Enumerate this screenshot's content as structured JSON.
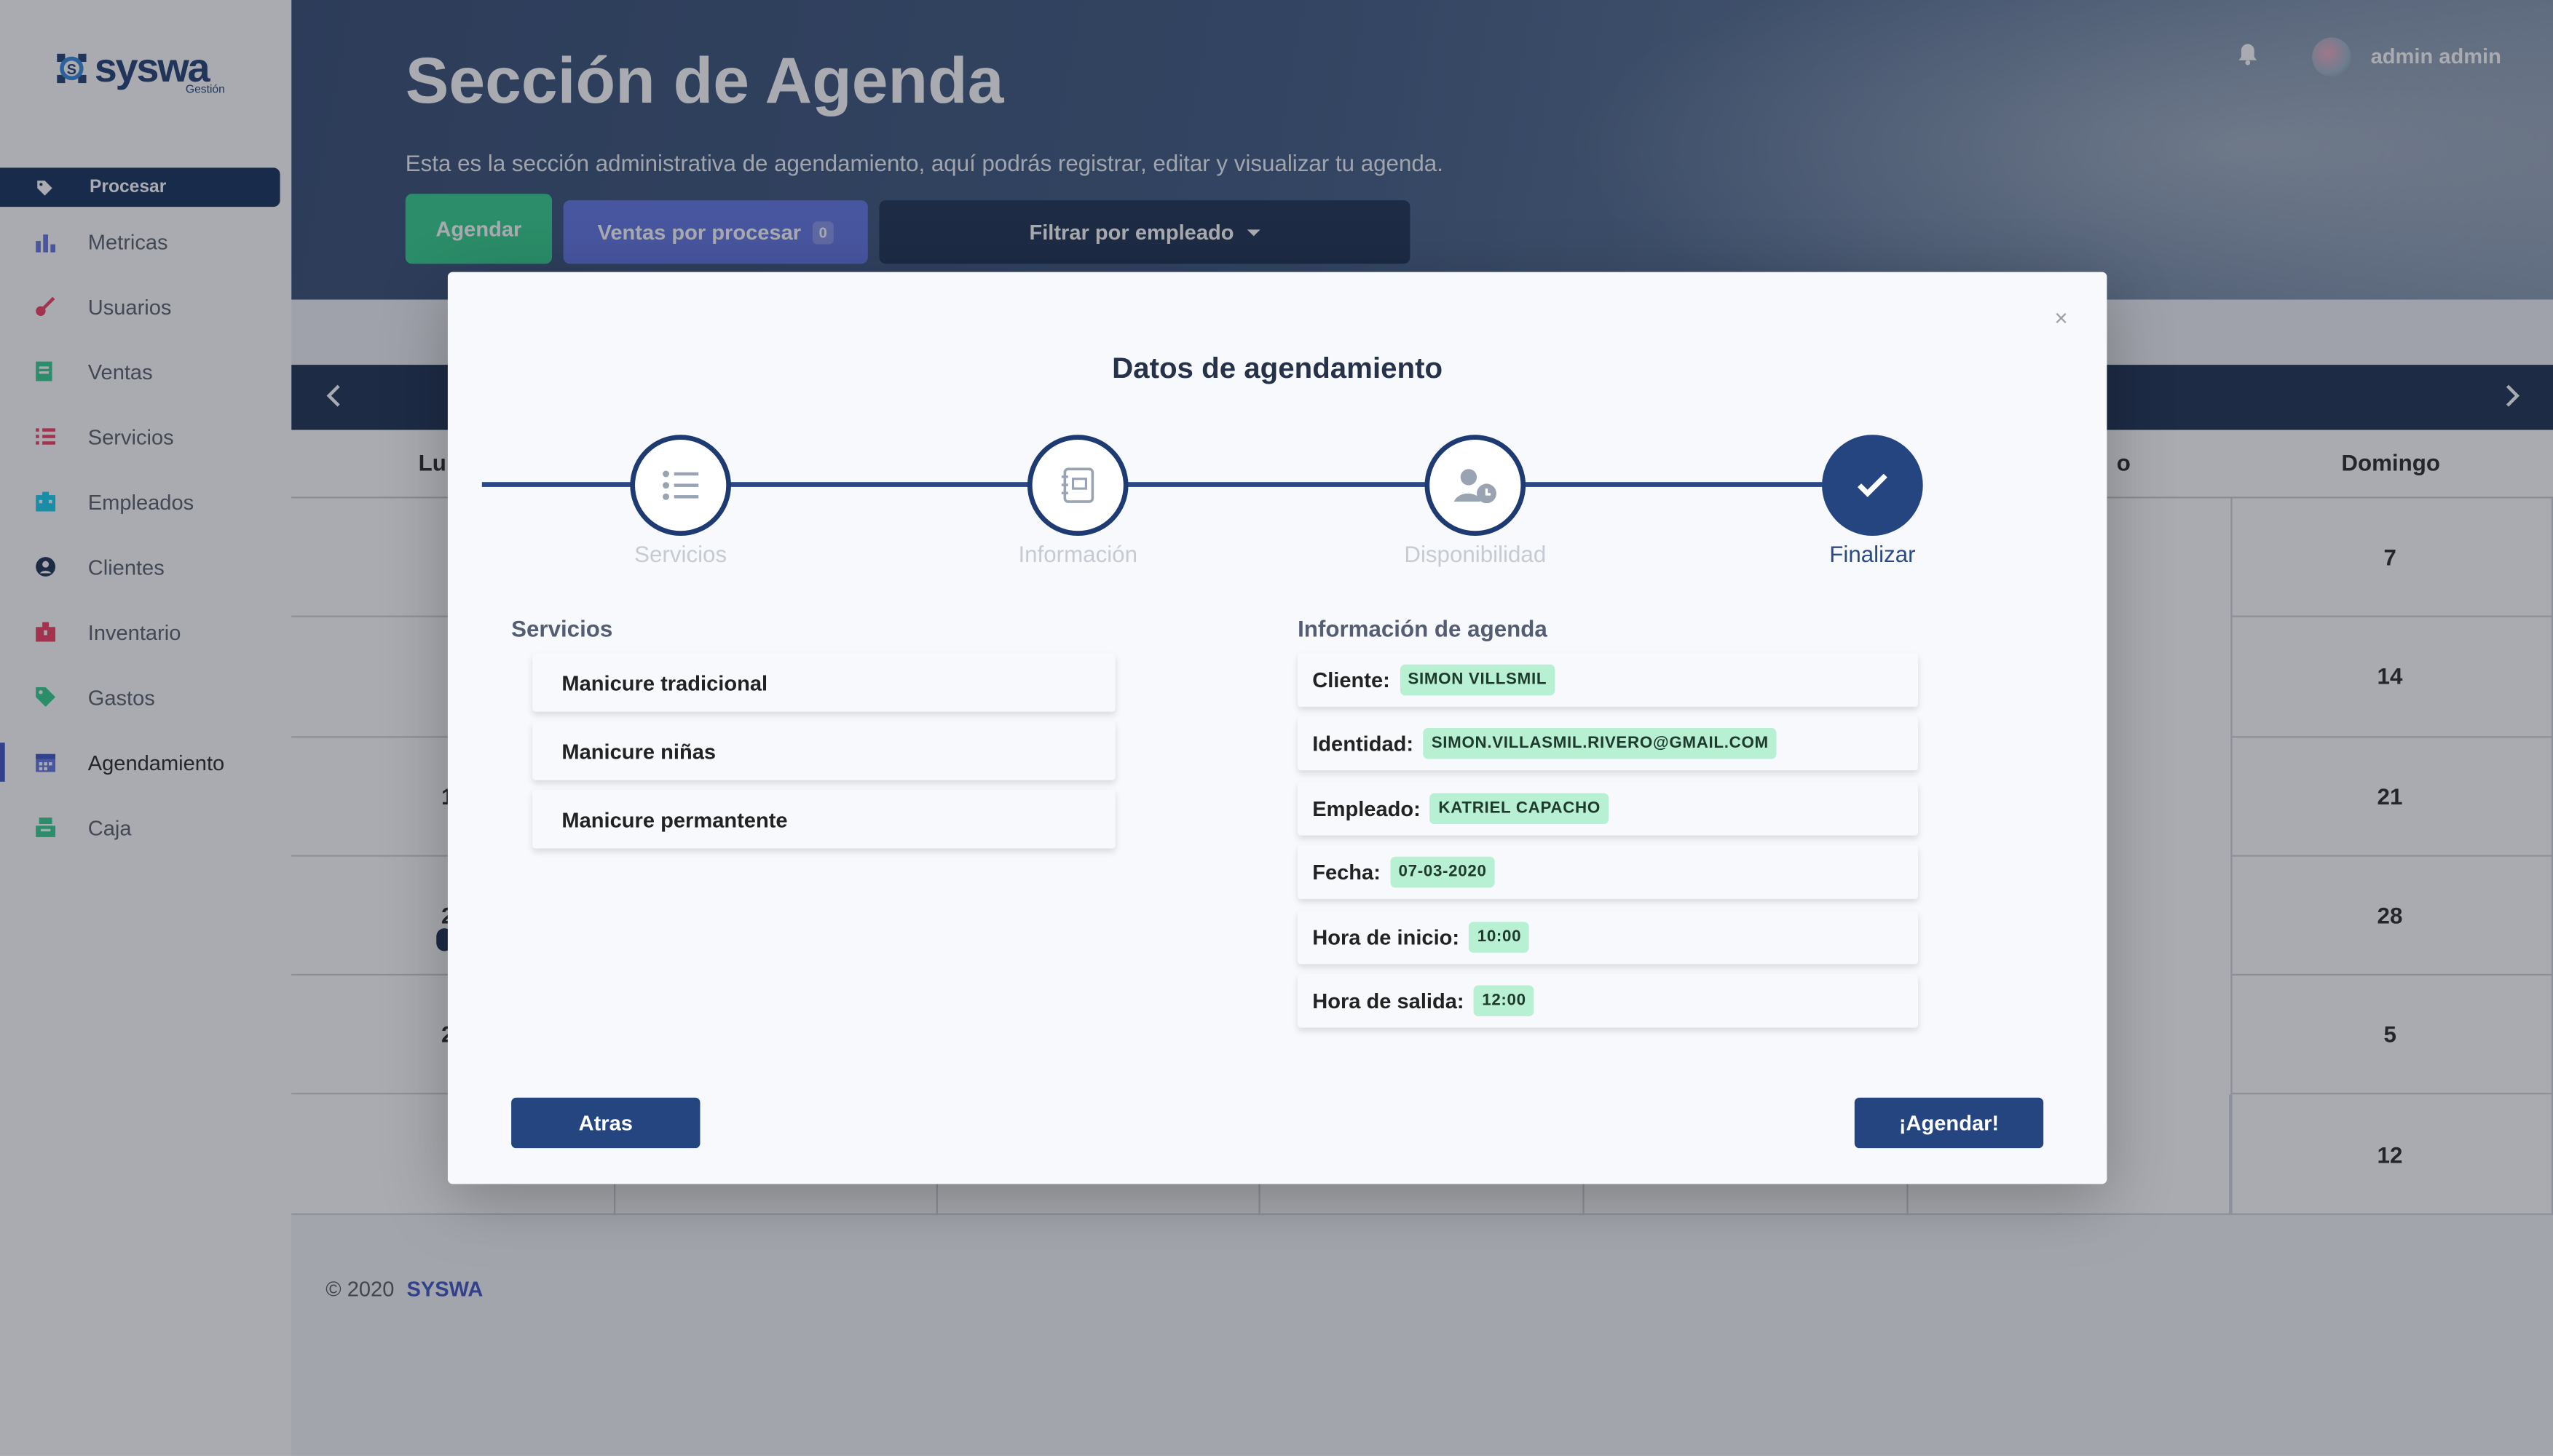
{
  "app": {
    "logo_text": "syswa",
    "logo_sub": "Gestión",
    "user_name": "admin admin"
  },
  "sidebar": {
    "highlight": "Procesar",
    "items": [
      {
        "label": "Metricas",
        "icon": "bar-chart-icon",
        "color": "#5e72e4"
      },
      {
        "label": "Usuarios",
        "icon": "key-icon",
        "color": "#f5365c"
      },
      {
        "label": "Ventas",
        "icon": "receipt-icon",
        "color": "#2dce89"
      },
      {
        "label": "Servicios",
        "icon": "list-icon",
        "color": "#f5365c"
      },
      {
        "label": "Empleados",
        "icon": "building-icon",
        "color": "#11cdef"
      },
      {
        "label": "Clientes",
        "icon": "user-circle-icon",
        "color": "#172b4d"
      },
      {
        "label": "Inventario",
        "icon": "box-icon",
        "color": "#f5365c"
      },
      {
        "label": "Gastos",
        "icon": "tag-icon",
        "color": "#2dce89"
      },
      {
        "label": "Agendamiento",
        "icon": "calendar-icon",
        "color": "#5e72e4"
      },
      {
        "label": "Caja",
        "icon": "cash-register-icon",
        "color": "#2dce89"
      }
    ]
  },
  "header": {
    "title": "Sección de Agenda",
    "subtitle": "Esta es la sección administrativa de agendamiento, aquí podrás registrar, editar y visualizar tu agenda.",
    "btn_agendar": "Agendar",
    "btn_ventas": "Ventas por procesar",
    "ventas_count": "0",
    "btn_filtrar": "Filtrar por empleado"
  },
  "calendar": {
    "day_first": "Lu",
    "day_last_partial": "o",
    "day_last": "Domingo",
    "left_partial_numbers": [
      "1",
      "2",
      "2"
    ],
    "sunday_numbers": [
      "7",
      "14",
      "21",
      "28",
      "5",
      "12"
    ]
  },
  "footer": {
    "copyright": "© 2020",
    "brand": "SYSWA"
  },
  "modal": {
    "close": "×",
    "title": "Datos de agendamiento",
    "steps": [
      {
        "label": "Servicios",
        "icon": "list-icon",
        "done": false
      },
      {
        "label": "Información",
        "icon": "notebook-icon",
        "done": false
      },
      {
        "label": "Disponibilidad",
        "icon": "user-clock-icon",
        "done": false
      },
      {
        "label": "Finalizar",
        "icon": "check-icon",
        "done": true
      }
    ],
    "services_title": "Servicios",
    "services": [
      "Manicure tradicional",
      "Manicure niñas",
      "Manicure permantente"
    ],
    "info_title": "Información de agenda",
    "info": [
      {
        "label": "Cliente:",
        "value": "SIMON VILLSMIL"
      },
      {
        "label": "Identidad:",
        "value": "SIMON.VILLASMIL.RIVERO@GMAIL.COM"
      },
      {
        "label": "Empleado:",
        "value": "KATRIEL CAPACHO"
      },
      {
        "label": "Fecha:",
        "value": "07-03-2020"
      },
      {
        "label": "Hora de inicio:",
        "value": "10:00"
      },
      {
        "label": "Hora de salida:",
        "value": "12:00"
      }
    ],
    "btn_back": "Atras",
    "btn_submit": "¡Agendar!"
  }
}
